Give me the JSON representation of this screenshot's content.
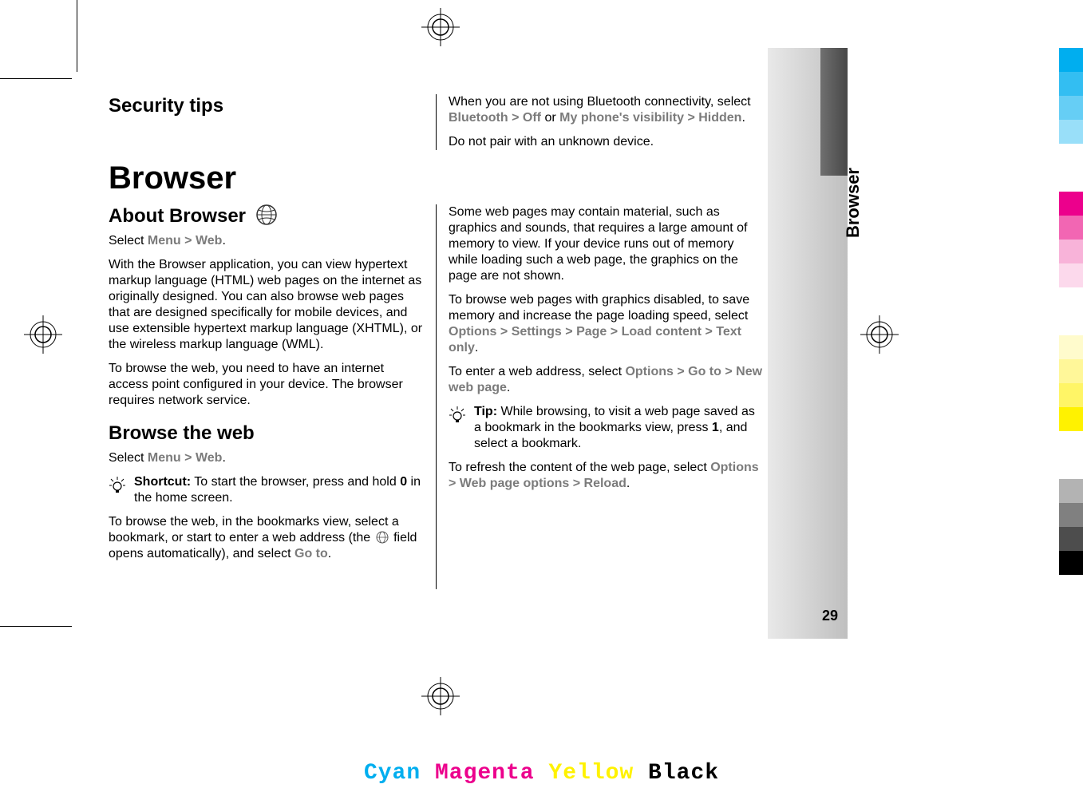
{
  "tab": {
    "label": "Browser",
    "page_number": "29"
  },
  "left": {
    "security_heading": "Security tips",
    "security_intro": "When you are not using Bluetooth connectivity, select ",
    "security_bt": "Bluetooth",
    "gt": " > ",
    "security_off": "Off",
    "security_or": " or ",
    "security_vis": "My phone's visibility",
    "security_hidden": "Hidden",
    "period": ".",
    "do_not_pair": "Do not pair with an unknown device.",
    "page_title": "Browser",
    "about_heading": "About Browser",
    "about_select": "Select ",
    "about_menu": "Menu",
    "about_web": "Web",
    "about_p1": "With the Browser application, you can view hypertext markup language (HTML) web pages on the internet as originally designed. You can also browse web pages that are designed specifically for mobile devices, and use extensible hypertext markup language (XHTML), or the wireless markup language (WML).",
    "about_p2": "To browse the web, you need to have an internet access point configured in your device. The browser requires network service.",
    "browse_heading": "Browse the web",
    "browse_select": "Select ",
    "browse_menu": "Menu",
    "browse_web": "Web",
    "shortcut_label": "Shortcut:",
    "shortcut_text_a": " To start the browser, press and hold ",
    "shortcut_key": "0",
    "shortcut_text_b": " in the home screen.",
    "r_p1_a": "To browse the web, in the bookmarks view, select a bookmark, or start to enter a web address (the ",
    "r_p1_b": " field opens automatically), and select ",
    "r_goto": "Go to",
    "r_p2": "Some web pages may contain material, such as graphics and sounds, that requires a large amount of memory to view. If your device runs out of memory while loading such a web page, the graphics on the page are not shown.",
    "r_p3_a": "To browse web pages with graphics disabled, to save memory and increase the page loading speed, select ",
    "r_options": "Options",
    "r_settings": "Settings",
    "r_page": "Page",
    "r_load": "Load content",
    "r_textonly": "Text only",
    "r_p4_a": "To enter a web address, select ",
    "r_goto2": "Go to",
    "r_newpage": "New web page",
    "tip_label": "Tip:",
    "tip_text_a": " While browsing, to visit a web page saved as a bookmark in the bookmarks view, press ",
    "tip_key": "1",
    "tip_text_b": ", and select a bookmark.",
    "r_p5_a": "To refresh the content of the web page, select ",
    "r_wpo": "Web page options",
    "r_reload": "Reload"
  },
  "cmyk": {
    "c": "Cyan",
    "m": "Magenta",
    "y": "Yellow",
    "k": "Black"
  },
  "colorbar": [
    "#00AEEF",
    "#33BEF2",
    "#66CEF5",
    "#99DFF9",
    "gap",
    "#EC008C",
    "#F266B3",
    "#F8B3D9",
    "#FCD9EC",
    "gap",
    "#FFFBCC",
    "#FFF799",
    "#FFF566",
    "#FFF200",
    "gap",
    "#B3B3B3",
    "#808080",
    "#4D4D4D",
    "#000000"
  ]
}
